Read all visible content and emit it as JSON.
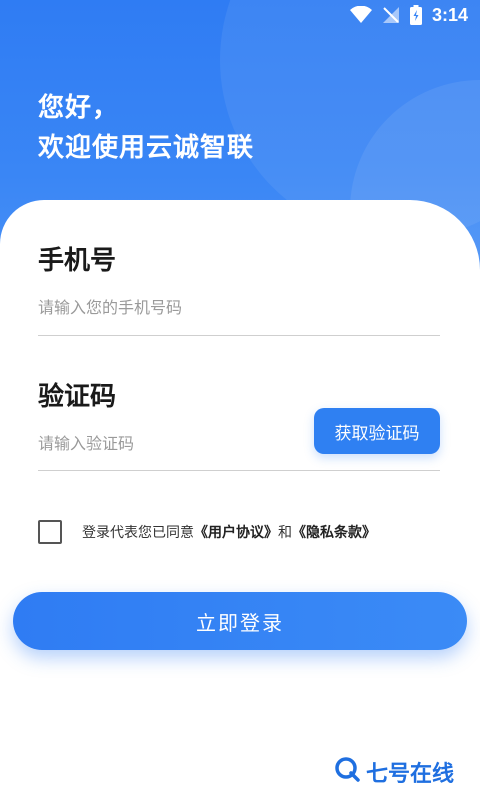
{
  "status_bar": {
    "time": "3:14",
    "icons": [
      "wifi-icon",
      "no-signal-icon",
      "battery-icon"
    ]
  },
  "header": {
    "greeting_line1": "您好，",
    "greeting_line2": "欢迎使用云诚智联"
  },
  "form": {
    "phone": {
      "label": "手机号",
      "placeholder": "请输入您的手机号码",
      "value": ""
    },
    "code": {
      "label": "验证码",
      "placeholder": "请输入验证码",
      "value": "",
      "button_label": "获取验证码"
    },
    "agreement": {
      "checked": false,
      "prefix": "登录代表您已同意",
      "user_agreement": "《用户协议》",
      "and": "和",
      "privacy_terms": "《隐私条款》"
    },
    "login_label": "立即登录"
  },
  "watermark": {
    "text": "七号在线"
  },
  "colors": {
    "primary": "#2f7cf3",
    "card": "#ffffff",
    "text": "#1a1a1a",
    "placeholder": "#9a9a9a",
    "watermark": "#1f6fe0"
  }
}
